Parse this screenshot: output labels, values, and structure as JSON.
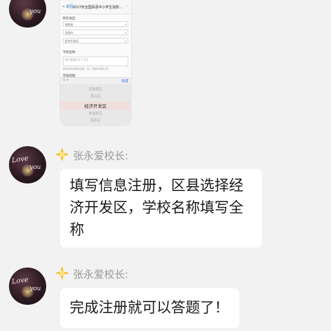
{
  "screenshot": {
    "back": "< 返回",
    "title": "2017年全国百县中小学生消防...",
    "menu": "···",
    "labels": [
      "所在地区:",
      "",
      "",
      "",
      "学校名称:",
      "年级班级:"
    ],
    "fields": [
      "湖南省",
      "岳阳市",
      "经济开发区"
    ],
    "textarea_placeholder": "请不要超过4个汉字",
    "note": "学校名称请填写全称，如：岳阳市某某小学",
    "toolbar_nav": "∧  ∨",
    "toolbar_done": "完成",
    "picker": [
      "岳阳楼区",
      "君山区",
      "经济开发区",
      "南湖新区",
      "屈原区"
    ]
  },
  "messages": [
    {
      "sender": "张永爱校长:",
      "text_lines": [
        "填写信息注册，区县选择经",
        "济开发区，学校名称填写全",
        "称"
      ]
    },
    {
      "sender": "张永爱校长:",
      "text_lines": [
        "完成注册就可以答题了！"
      ]
    }
  ],
  "avatar_text": {
    "love": "Love",
    "you": "you"
  },
  "colors": {
    "background": "#f2f2f2",
    "bubble": "#ffffff",
    "sender_name": "#9a9a9a",
    "star": "#f2b91d"
  }
}
